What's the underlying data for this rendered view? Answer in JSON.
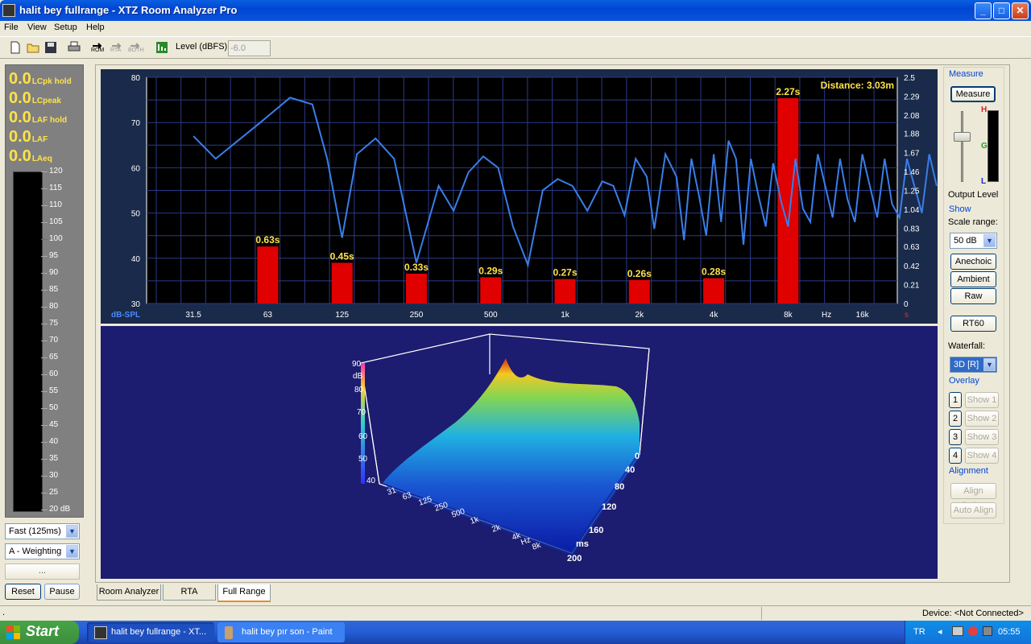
{
  "window": {
    "title": "halit bey fullrange - XTZ Room Analyzer Pro",
    "min": "_",
    "max": "□",
    "close": "✕"
  },
  "menu": [
    "File",
    "View",
    "Setup",
    "Help"
  ],
  "toolbar": {
    "rom": "ROM",
    "rta": "RTA",
    "both": "BOTH",
    "level_label": "Level (dBFS)",
    "level_value": "-6.0"
  },
  "readouts": [
    {
      "value": "0.0",
      "label": "LCpk hold"
    },
    {
      "value": "0.0",
      "label": "LCpeak"
    },
    {
      "value": "0.0",
      "label": "LAF hold"
    },
    {
      "value": "0.0",
      "label": "LAF"
    },
    {
      "value": "0.0",
      "label": "LAeq"
    }
  ],
  "meter_scale": [
    "120",
    "115",
    "110",
    "105",
    "100",
    "95",
    "90",
    "85",
    "80",
    "75",
    "70",
    "65",
    "60",
    "55",
    "50",
    "45",
    "40",
    "35",
    "30",
    "25",
    "20 dB"
  ],
  "left_controls": {
    "speed": "Fast (125ms)",
    "weighting": "A - Weighting",
    "more": "...",
    "reset": "Reset",
    "pause": "Pause"
  },
  "chart_data": {
    "type": "bar",
    "title": "",
    "annotation": "Distance: 3.03m",
    "xlabel": "Hz",
    "ylabel": "dB-SPL",
    "y2label": "s",
    "x_ticks": [
      "31.5",
      "63",
      "125",
      "250",
      "500",
      "1k",
      "2k",
      "4k",
      "8k",
      "16k"
    ],
    "y_ticks": [
      "80",
      "70",
      "60",
      "50",
      "40",
      "30"
    ],
    "y2_ticks": [
      "2.5",
      "2.29",
      "2.08",
      "1.88",
      "1.67",
      "1.46",
      "1.25",
      "1.04",
      "0.83",
      "0.63",
      "0.42",
      "0.21",
      "0"
    ],
    "ylim": [
      30,
      80
    ],
    "y2lim": [
      0,
      2.5
    ],
    "categories": [
      "63",
      "125",
      "250",
      "500",
      "1k",
      "2k",
      "4k",
      "8k"
    ],
    "values": [
      0.63,
      0.45,
      0.33,
      0.29,
      0.27,
      0.26,
      0.28,
      2.27
    ],
    "value_labels": [
      "0.63s",
      "0.45s",
      "0.33s",
      "0.29s",
      "0.27s",
      "0.26s",
      "0.28s",
      "2.27s"
    ],
    "line_series": {
      "name": "",
      "x_log2_from_31_5": [
        0,
        0.3,
        0.6,
        0.9,
        1.3,
        1.6,
        1.8,
        2.0,
        2.2,
        2.45,
        2.7,
        3.0,
        3.3,
        3.5,
        3.7,
        3.9,
        4.1,
        4.3,
        4.5,
        4.7,
        4.9,
        5.1,
        5.3,
        5.5,
        5.65,
        5.8,
        5.95,
        6.1,
        6.2,
        6.35,
        6.5,
        6.6,
        6.7,
        6.8,
        6.9,
        7.0,
        7.1,
        7.2,
        7.3,
        7.4,
        7.5,
        7.6,
        7.7,
        7.8,
        7.9,
        8.0,
        8.1,
        8.2,
        8.3,
        8.4,
        8.5,
        8.6,
        8.7,
        8.8,
        8.9,
        9.0,
        9.1,
        9.2,
        9.3,
        9.4,
        9.5,
        9.6,
        9.7,
        9.8,
        9.9,
        10.0
      ],
      "y_db": [
        67,
        62,
        66,
        70,
        75.5,
        74,
        62,
        44.5,
        63,
        66.5,
        62,
        39,
        56,
        50.5,
        59,
        62.5,
        60,
        47,
        38.5,
        55,
        57.5,
        56,
        50.5,
        57,
        56,
        49.5,
        62,
        58,
        46.5,
        63,
        58,
        44,
        62,
        54,
        45,
        63,
        48,
        66,
        62,
        43,
        62,
        54,
        47,
        61,
        53,
        47,
        62,
        51,
        48,
        63,
        56,
        49,
        62,
        53,
        48,
        63,
        56,
        49,
        62,
        52,
        49,
        62,
        56,
        50,
        63,
        56
      ]
    },
    "legend": "none",
    "grid": true
  },
  "waterfall": {
    "db_ticks": [
      "90",
      "dB",
      "80",
      "70",
      "60",
      "50",
      "40"
    ],
    "freq_ticks": [
      "31",
      "63",
      "125",
      "250",
      "500",
      "1k",
      "2k",
      "4k",
      "Hz",
      "8k"
    ],
    "ms_ticks": [
      "0",
      "40",
      "80",
      "120",
      "160",
      "ms",
      "200"
    ]
  },
  "right": {
    "measure_group": "Measure",
    "measure_btn": "Measure",
    "led_h": "H",
    "led_g": "G",
    "led_l": "L",
    "output_level": "Output Level",
    "show_group": "Show",
    "scale_label": "Scale range:",
    "scale_value": "50 dB",
    "anechoic": "Anechoic",
    "ambient": "Ambient",
    "raw": "Raw",
    "rt60": "RT60",
    "waterfall_label": "Waterfall:",
    "waterfall_value": "3D [R]",
    "overlay_group": "Overlay",
    "overlays": [
      {
        "n": "1",
        "label": "Show 1"
      },
      {
        "n": "2",
        "label": "Show 2"
      },
      {
        "n": "3",
        "label": "Show 3"
      },
      {
        "n": "4",
        "label": "Show 4"
      }
    ],
    "alignment_group": "Alignment",
    "align_delay": "Align Delay",
    "auto_align": "Auto Align"
  },
  "tabs": [
    "Room Analyzer",
    "RTA",
    "Full Range"
  ],
  "status": {
    "left": ".",
    "device": "Device: <Not Connected>"
  },
  "taskbar": {
    "start": "Start",
    "tasks": [
      "halit bey fullrange - XT...",
      "halit bey pır son - Paint"
    ],
    "lang": "TR",
    "time": "05:55"
  }
}
